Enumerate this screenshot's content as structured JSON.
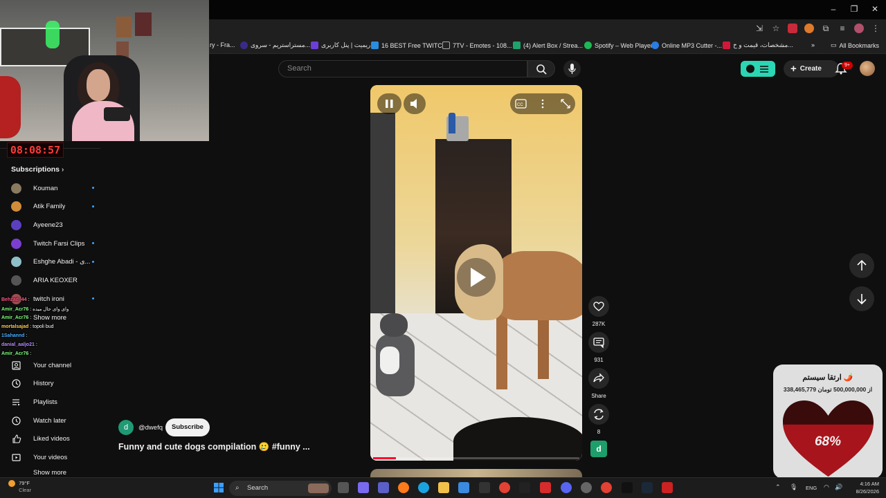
{
  "browser": {
    "bookmarks": [
      {
        "label": "ry - Fra...",
        "color": "#555555"
      },
      {
        "label": "مستراستریم - سروی...",
        "color": "#3a2a88"
      },
      {
        "label": "ریمیت | پنل کاربری",
        "color": "#6b3fd6"
      },
      {
        "label": "16 BEST Free TWITC...",
        "color": "#2a8de0"
      },
      {
        "label": "7TV - Emotes - 108...",
        "color": "#222222"
      },
      {
        "label": "(4) Alert Box / Strea...",
        "color": "#1da36b"
      },
      {
        "label": "Spotify – Web Player",
        "color": "#1db954"
      },
      {
        "label": "Online MP3 Cutter -...",
        "color": "#2a7de1"
      },
      {
        "label": "مشخصات، قیمت و خ...",
        "color": "#d0193a"
      }
    ],
    "all_bookmarks": "All Bookmarks"
  },
  "youtube": {
    "search_placeholder": "Search",
    "create_label": "Create",
    "notification_count": "9+"
  },
  "stream": {
    "timer": "08:08:57"
  },
  "sidebar": {
    "subscriptions_title": "Subscriptions",
    "channels": [
      {
        "name": "Kouman",
        "color": "#8a7a60",
        "dot": true
      },
      {
        "name": "Atik Family",
        "color": "#d08c3a",
        "dot": true
      },
      {
        "name": "Ayeene23",
        "color": "#5a40c0",
        "dot": false
      },
      {
        "name": "Twitch Farsi Clips",
        "color": "#7a3fd0",
        "dot": true
      },
      {
        "name": "Eshghe Abadi - ی...",
        "color": "#8fbfc9",
        "dot": true
      },
      {
        "name": "ARIA KEOXER",
        "color": "#555555",
        "dot": false
      },
      {
        "name": "twitch ironi",
        "color": "#a05050",
        "dot": true
      }
    ],
    "show_more": "Show more",
    "you_items": [
      {
        "label": "Your channel",
        "icon": "your-channel-icon"
      },
      {
        "label": "History",
        "icon": "history-icon"
      },
      {
        "label": "Playlists",
        "icon": "playlists-icon"
      },
      {
        "label": "Watch later",
        "icon": "watch-later-icon"
      },
      {
        "label": "Liked videos",
        "icon": "liked-videos-icon"
      },
      {
        "label": "Your videos",
        "icon": "your-videos-icon"
      }
    ],
    "show_more_bottom": "Show more"
  },
  "chat": [
    {
      "user": "Behzad_44",
      "user_color": "#ff5a8a",
      "text": ":"
    },
    {
      "user": "Amir_Acr76",
      "user_color": "#7cff7c",
      "text": ": وای وای حال میده"
    },
    {
      "user": "Amir_Acr76",
      "user_color": "#7cff7c",
      "text": ":"
    },
    {
      "user": "mortalsajad",
      "user_color": "#ffd24a",
      "text": ": topoli bud"
    },
    {
      "user": "1Sahannd",
      "user_color": "#4ab0ff",
      "text": ":"
    },
    {
      "user": "danial_aaljo21",
      "user_color": "#b58cff",
      "text": ":"
    },
    {
      "user": "Amir_Acr76",
      "user_color": "#7cff7c",
      "text": ":"
    }
  ],
  "short": {
    "channel_handle": "@dwefq",
    "channel_initial": "d",
    "subscribe_label": "Subscribe",
    "title": "Funny and cute dogs compilation 🥲   #funny ...",
    "progress": 0.11,
    "likes": "287K",
    "comments": "931",
    "share_label": "Share",
    "remix_count": "8"
  },
  "donation": {
    "title": "ارتقا سیستم 🌶️",
    "amount_text": "338,465,779 از 500,000,000 تومان",
    "percent": "68%",
    "fraction": 0.68
  },
  "taskbar": {
    "temperature": "79°F",
    "condition": "Clear",
    "search_label": "Search",
    "lang": "ENG",
    "time": "4:16 AM",
    "date": "8/26/2026"
  }
}
